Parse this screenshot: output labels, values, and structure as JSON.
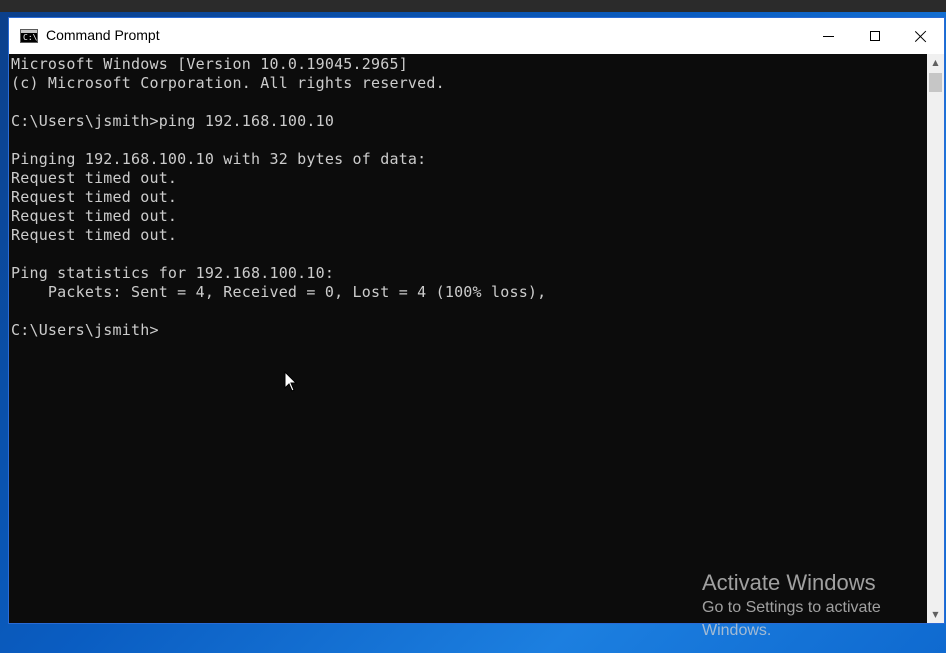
{
  "window": {
    "title": "Command Prompt",
    "icon": "cmd-icon",
    "icon_glyph": "C:\\"
  },
  "console_lines": [
    "Microsoft Windows [Version 10.0.19045.2965]",
    "(c) Microsoft Corporation. All rights reserved.",
    "",
    "C:\\Users\\jsmith>ping 192.168.100.10",
    "",
    "Pinging 192.168.100.10 with 32 bytes of data:",
    "Request timed out.",
    "Request timed out.",
    "Request timed out.",
    "Request timed out.",
    "",
    "Ping statistics for 192.168.100.10:",
    "    Packets: Sent = 4, Received = 0, Lost = 4 (100% loss),",
    "",
    "C:\\Users\\jsmith>"
  ],
  "scrollbar": {
    "up_arrow": "▲",
    "down_arrow": "▼"
  },
  "watermark": {
    "title": "Activate Windows",
    "line1": "Go to Settings to activate",
    "line2": "Windows."
  },
  "colors": {
    "console_bg": "#0c0c0c",
    "console_text": "#cccccc",
    "titlebar_bg": "#ffffff",
    "window_border": "#2a6bd6"
  }
}
